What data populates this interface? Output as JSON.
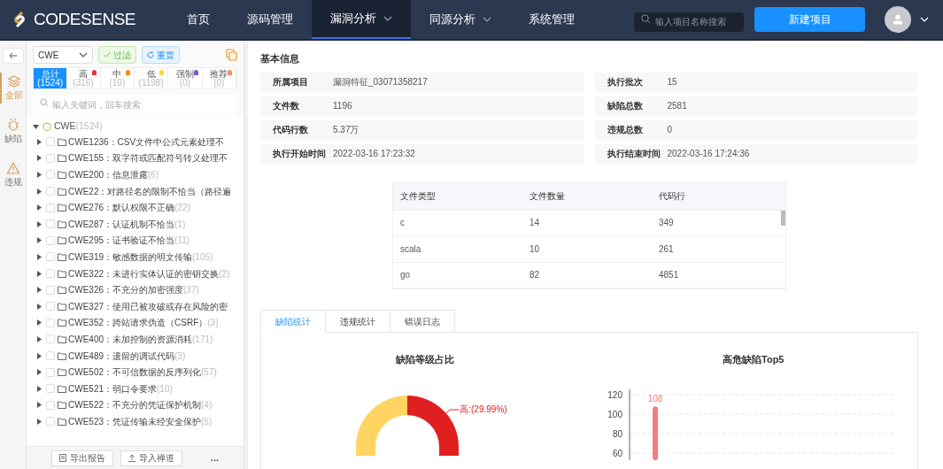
{
  "logo": "CODESENSE",
  "nav": [
    {
      "label": "首页",
      "selected": false,
      "dropdown": false
    },
    {
      "label": "源码管理",
      "selected": false,
      "dropdown": false
    },
    {
      "label": "漏洞分析",
      "selected": true,
      "dropdown": true
    },
    {
      "label": "同源分析",
      "selected": false,
      "dropdown": true
    },
    {
      "label": "系统管理",
      "selected": false,
      "dropdown": false
    }
  ],
  "project_search": {
    "placeholder": "输入项目名称搜索"
  },
  "new_project_button": "新建项目",
  "rail": [
    {
      "label": "全部",
      "kind": "layers",
      "selected": true
    },
    {
      "label": "缺陷",
      "kind": "bug",
      "selected": false
    },
    {
      "label": "违规",
      "kind": "warning",
      "selected": false
    }
  ],
  "filter": {
    "select": "CWE",
    "filter_button": "过滤",
    "reset_button": "重置"
  },
  "levels": [
    {
      "label": "总计",
      "count": "(1524)",
      "selected": true,
      "color": "#1890ff"
    },
    {
      "label": "高",
      "count": "(316)",
      "selected": false,
      "color": "#e53935"
    },
    {
      "label": "中",
      "count": "(10)",
      "selected": false,
      "color": "#fb8c00"
    },
    {
      "label": "低",
      "count": "(1198)",
      "selected": false,
      "color": "#fdd835"
    },
    {
      "label": "强制",
      "count": "(0)",
      "selected": false,
      "color": "#7e57c2"
    },
    {
      "label": "推荐",
      "count": "(0)",
      "selected": false,
      "color": "#ff8a65"
    }
  ],
  "keyword_search": {
    "placeholder": "输入关键词，回车搜索"
  },
  "tree": {
    "label": "CWE",
    "count": "(1524)",
    "expanded": true,
    "children": [
      {
        "label": "CWE1236：CSV文件中公式元素处理不",
        "checked": false
      },
      {
        "label": "CWE155：双字符或匹配符号转义处理不",
        "checked": false
      },
      {
        "label": "CWE200：信息泄露",
        "count": "(6)",
        "checked": false
      },
      {
        "label": "CWE22：对路径名的限制不恰当（路径遍",
        "checked": false
      },
      {
        "label": "CWE276：默认权限不正确",
        "count": "(22)",
        "checked": false
      },
      {
        "label": "CWE287：认证机制不恰当",
        "count": "(1)",
        "checked": false
      },
      {
        "label": "CWE295：证书验证不恰当",
        "count": "(11)",
        "checked": false
      },
      {
        "label": "CWE319：敏感数据的明文传输",
        "count": "(105)",
        "checked": false
      },
      {
        "label": "CWE322：未进行实体认证的密钥交换",
        "count": "(2)",
        "checked": false
      },
      {
        "label": "CWE326：不充分的加密强度",
        "count": "(37)",
        "checked": false
      },
      {
        "label": "CWE327：使用已被攻破或存在风险的密",
        "checked": false
      },
      {
        "label": "CWE352：跨站请求伪造（CSRF）",
        "count": "(3)",
        "checked": false
      },
      {
        "label": "CWE400：未加控制的资源消耗",
        "count": "(171)",
        "checked": false
      },
      {
        "label": "CWE489：遗留的调试代码",
        "count": "(3)",
        "checked": false
      },
      {
        "label": "CWE502：不可信数据的反序列化",
        "count": "(57)",
        "checked": false
      },
      {
        "label": "CWE521：弱口令要求",
        "count": "(10)",
        "checked": false
      },
      {
        "label": "CWE522：不充分的凭证保护机制",
        "count": "(4)",
        "checked": false
      },
      {
        "label": "CWE523：凭证传输未经安全保护",
        "count": "(5)",
        "checked": false
      }
    ]
  },
  "sidebar_footer": {
    "export_button": "导出报告",
    "import_button": "导入禅道",
    "more": "..."
  },
  "basic_info": {
    "title": "基本信息",
    "fields": [
      {
        "label": "所属项目",
        "value": "漏洞特征_03071358217"
      },
      {
        "label": "执行批次",
        "value": "15"
      },
      {
        "label": "文件数",
        "value": "1196"
      },
      {
        "label": "缺陷总数",
        "value": "2581"
      },
      {
        "label": "代码行数",
        "value": "5.37万"
      },
      {
        "label": "违规总数",
        "value": "0"
      },
      {
        "label": "执行开始时间",
        "value": "2022-03-16 17:23:32"
      },
      {
        "label": "执行结束时间",
        "value": "2022-03-16 17:24:36"
      }
    ]
  },
  "file_table": {
    "columns": [
      "文件类型",
      "文件数量",
      "代码行"
    ],
    "rows": [
      [
        "c",
        "14",
        "349"
      ],
      [
        "scala",
        "10",
        "261"
      ],
      [
        "go",
        "82",
        "4851"
      ]
    ]
  },
  "stats_tabs": [
    {
      "label": "缺陷统计",
      "selected": true
    },
    {
      "label": "违规统计",
      "selected": false
    },
    {
      "label": "错误日志",
      "selected": false
    }
  ],
  "level_chart": {
    "title": "缺陷等级占比",
    "label": "高:(29.99%)"
  },
  "top5_chart": {
    "title": "高危缺陷Top5",
    "chart_data": {
      "type": "bar",
      "series": [
        {
          "color": "#f47c7c",
          "values": [
            108
          ]
        }
      ],
      "ylim": [
        60,
        120
      ],
      "yticks": [
        60,
        80,
        100,
        120
      ],
      "data_labels": true
    }
  }
}
